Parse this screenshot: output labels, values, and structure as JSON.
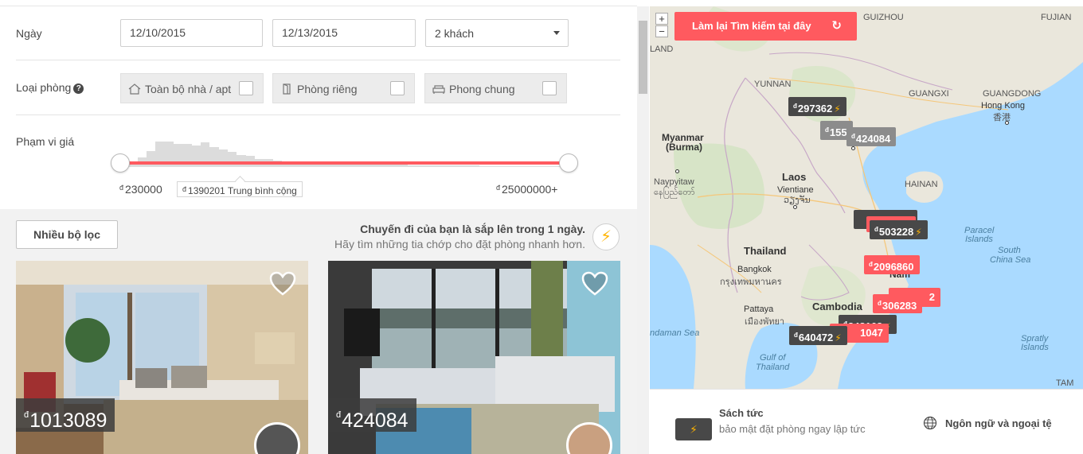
{
  "filters": {
    "dates_label": "Ngày",
    "checkin": "12/10/2015",
    "checkout": "12/13/2015",
    "guests": "2 khách",
    "room_type_label": "Loại phòng",
    "help_glyph": "?",
    "room_types": [
      {
        "label": "Toàn bộ nhà / apt",
        "icon": "home-icon",
        "checked": false
      },
      {
        "label": "Phòng riêng",
        "icon": "door-icon",
        "checked": false
      },
      {
        "label": "Phong chung",
        "icon": "couch-icon",
        "checked": false
      }
    ],
    "price_range_label": "Phạm vi giá",
    "price_min": "230000",
    "price_max": "25000000+",
    "price_avg": "1390201 Trung bình cộng",
    "currency_symbol": "đ",
    "histogram": [
      0.15,
      0.2,
      0.35,
      0.6,
      0.95,
      0.95,
      0.85,
      0.85,
      0.8,
      0.9,
      0.75,
      0.65,
      0.55,
      0.45,
      0.4,
      0.3,
      0.28,
      0.25,
      0.2,
      0.2,
      0.18,
      0.18,
      0.15,
      0.15,
      0.12,
      0.12,
      0.1,
      0.1,
      0.1,
      0.08,
      0.08,
      0.08,
      0.06,
      0.06,
      0.06,
      0.05,
      0.05,
      0.05,
      0.05,
      0.05,
      0.04,
      0.04,
      0.04,
      0.04,
      0.04,
      0.04,
      0.03,
      0.03,
      0.03,
      0.03
    ]
  },
  "more_filters_label": "Nhiều bộ lọc",
  "trip_notice": {
    "title": "Chuyến đi của bạn là sắp lên trong 1 ngày.",
    "subtitle": "Hãy tìm những tia chớp cho đặt phòng nhanh hơn.",
    "bolt_glyph": "⚡"
  },
  "listings": [
    {
      "price": "1013089"
    },
    {
      "price": "424084"
    }
  ],
  "map": {
    "redo_search": "Làm lại Tìm kiếm tại đây",
    "zoom_in": "+",
    "zoom_out": "−",
    "labels": {
      "guizhou": "GUIZHOU",
      "fujian": "FUJIAN",
      "yunnan": "YUNNAN",
      "guangxi": "GUANGXI",
      "guangdong": "GUANGDONG",
      "hong_kong": "Hong Kong",
      "hong_kong_zh": "香港",
      "myanmar": "Myanmar",
      "burma": "(Burma)",
      "laos": "Laos",
      "vientiane": "Vientiane",
      "vientiane_local": "ວຽງຈັນ",
      "naypyitaw": "Naypyitaw",
      "naypyitaw_local": "နေပြည်တော်",
      "hainan": "HAINAN",
      "paracel": "Paracel",
      "islands": "Islands",
      "thailand": "Thailand",
      "bangkok": "Bangkok",
      "bangkok_local": "กรุงเทพมหานคร",
      "south": "South",
      "china_sea": "China Sea",
      "vietnam_frag": "Nam",
      "pattaya": "Pattaya",
      "pattaya_local": "เมืองพัทยา",
      "cambodia": "Cambodia",
      "andaman": "ndaman Sea",
      "gulf_of": "Gulf of",
      "gulf_thailand": "Thailand",
      "spratly": "Spratly",
      "spratly_islands": "Islands",
      "land": "LAND",
      "tam": "TAM"
    },
    "pins": [
      {
        "price": "297362",
        "style": "dark",
        "bolt": true
      },
      {
        "price": "155",
        "style": "gray",
        "bolt": false
      },
      {
        "price": "424084",
        "style": "gray",
        "bolt": false
      },
      {
        "price": "",
        "style": "dark",
        "bolt": false
      },
      {
        "price": "503228",
        "style": "dark",
        "bolt": true
      },
      {
        "price": "2096860",
        "style": "red",
        "bolt": false
      },
      {
        "price": "2",
        "style": "red",
        "bolt": false
      },
      {
        "price": "306283",
        "style": "red",
        "bolt": false
      },
      {
        "price": "848163",
        "style": "dark",
        "bolt": true
      },
      {
        "price": "1047",
        "style": "red",
        "bolt": false
      },
      {
        "price": "640472",
        "style": "dark",
        "bolt": true
      }
    ]
  },
  "map_footer": {
    "instant_title": "Sách tức",
    "instant_desc": "bảo mật đặt phòng ngay lập tức",
    "language_label": "Ngôn ngữ và ngoại tệ"
  },
  "colors": {
    "accent": "#ff5a5f",
    "bolt": "#ffb400",
    "pin_dark": "#484848"
  }
}
